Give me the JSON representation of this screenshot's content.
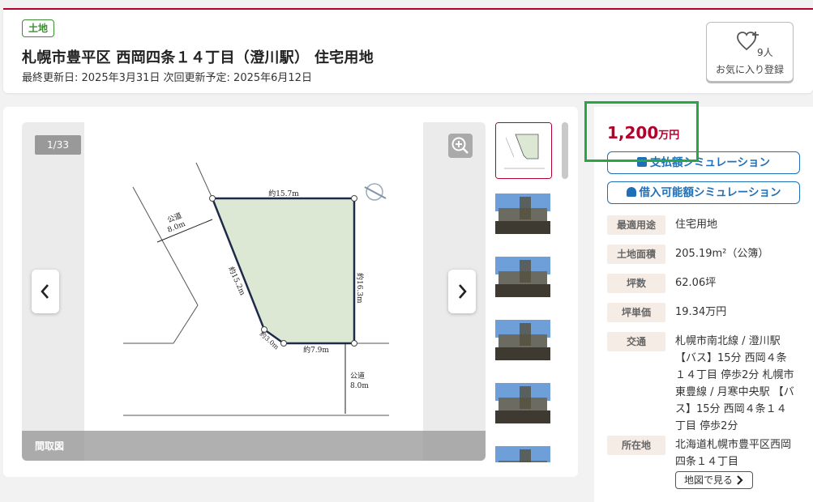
{
  "header": {
    "tag": "土地",
    "title": "札幌市豊平区 西岡四条１４丁目（澄川駅） 住宅用地",
    "updated": "最終更新日: 2025年3月31日 次回更新予定: 2025年6月12日",
    "favorite": {
      "count": "9人",
      "label": "お気に入り登録"
    }
  },
  "gallery": {
    "counter": "1/33",
    "caption": "間取図",
    "plan_labels": {
      "top": "約15.7m",
      "right": "約16.3m",
      "left": "約15.2m",
      "bottom_left": "約3.0m",
      "bottom": "約7.9m",
      "road_left": "公道",
      "road_left_width": "8.0m",
      "road_bottom": "公道",
      "road_bottom_width": "8.0m"
    },
    "thumbnails": [
      "floor-plan",
      "photo",
      "photo",
      "photo",
      "photo",
      "photo"
    ]
  },
  "summary": {
    "price_value": "1,200",
    "price_unit": "万円",
    "sim_payment": "支払額シミュレーション",
    "sim_borrow": "借入可能額シミュレーション",
    "rows": [
      {
        "label": "最適用途",
        "value": "住宅用地"
      },
      {
        "label": "土地面積",
        "value": "205.19m²（公簿）"
      },
      {
        "label": "坪数",
        "value": "62.06坪"
      },
      {
        "label": "坪単価",
        "value": "19.34万円"
      },
      {
        "label": "交通",
        "value": "札幌市南北線 / 澄川駅 【バス】15分 西岡４条１４丁目 停歩2分 札幌市東豊線 / 月寒中央駅 【バス】15分 西岡４条１４丁目 停歩2分"
      },
      {
        "label": "所在地",
        "value": "北海道札幌市豊平区西岡四条１４丁目"
      }
    ],
    "map_button": "地図で見る"
  },
  "colors": {
    "accent": "#b3002d",
    "link": "#1f6fb8",
    "tag_green": "#3a8f2e",
    "highlight": "#26a645",
    "plot_fill": "#dde8d4"
  }
}
